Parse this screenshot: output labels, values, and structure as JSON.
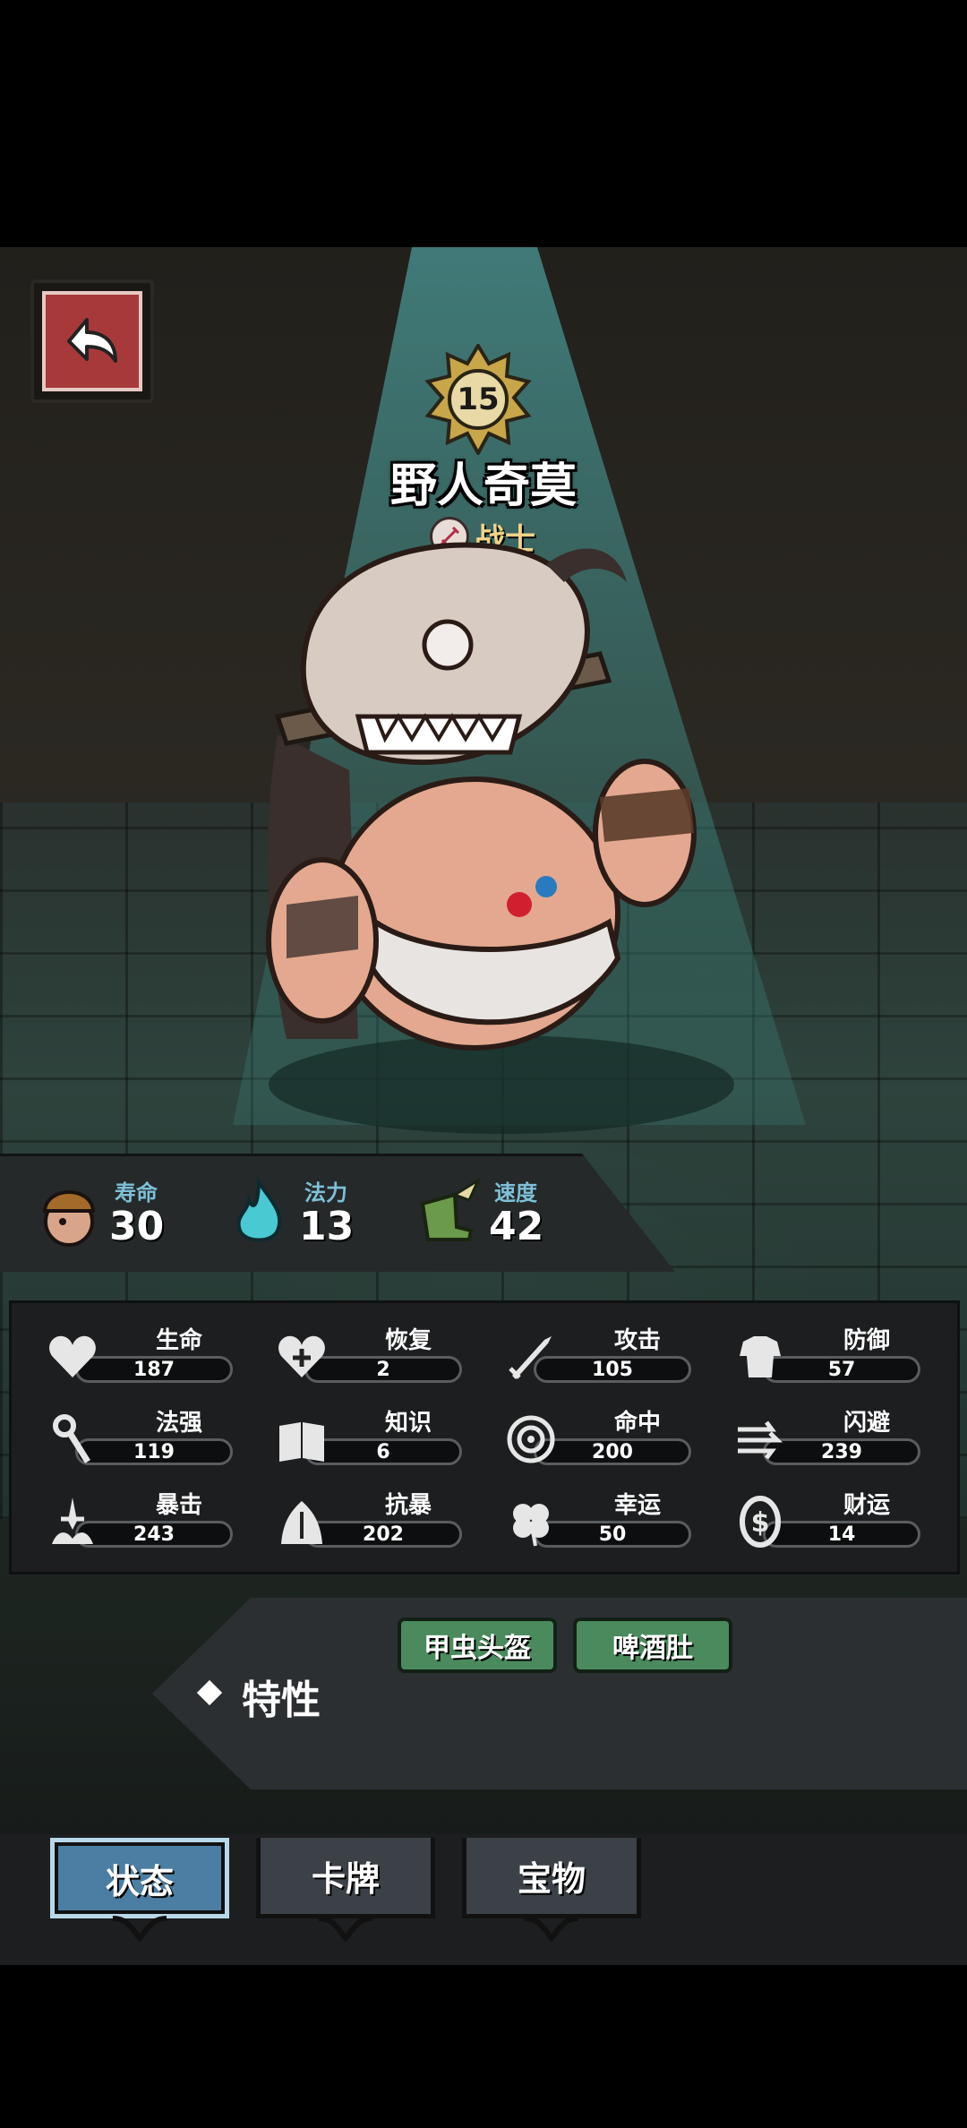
{
  "hero": {
    "level": "15",
    "name": "野人奇莫",
    "class": "战士"
  },
  "attributes": [
    {
      "label": "寿命",
      "value": "30",
      "icon": "helmet-portrait-icon"
    },
    {
      "label": "法力",
      "value": "13",
      "icon": "blue-flame-icon"
    },
    {
      "label": "速度",
      "value": "42",
      "icon": "winged-boot-icon"
    }
  ],
  "stats": [
    {
      "label": "生命",
      "value": "187",
      "icon": "heart-icon"
    },
    {
      "label": "恢复",
      "value": "2",
      "icon": "heart-plus-icon"
    },
    {
      "label": "攻击",
      "value": "105",
      "icon": "sword-icon"
    },
    {
      "label": "防御",
      "value": "57",
      "icon": "armor-icon"
    },
    {
      "label": "法强",
      "value": "119",
      "icon": "staff-icon"
    },
    {
      "label": "知识",
      "value": "6",
      "icon": "book-icon"
    },
    {
      "label": "命中",
      "value": "200",
      "icon": "target-icon"
    },
    {
      "label": "闪避",
      "value": "239",
      "icon": "dodge-arrows-icon"
    },
    {
      "label": "暴击",
      "value": "243",
      "icon": "crit-dagger-icon"
    },
    {
      "label": "抗暴",
      "value": "202",
      "icon": "shield-crest-icon"
    },
    {
      "label": "幸运",
      "value": "50",
      "icon": "clover-icon"
    },
    {
      "label": "财运",
      "value": "14",
      "icon": "coin-icon"
    }
  ],
  "traits": {
    "title": "特性",
    "tags": [
      "甲虫头盔",
      "啤酒肚"
    ]
  },
  "tabs": [
    {
      "label": "状态",
      "active": true
    },
    {
      "label": "卡牌",
      "active": false
    },
    {
      "label": "宝物",
      "active": false
    }
  ],
  "colors": {
    "accent_blue": "#4c7ea3",
    "trait_green": "#4a8a5d",
    "attr_label": "#7ec0d7",
    "back_red": "#a8393a"
  }
}
